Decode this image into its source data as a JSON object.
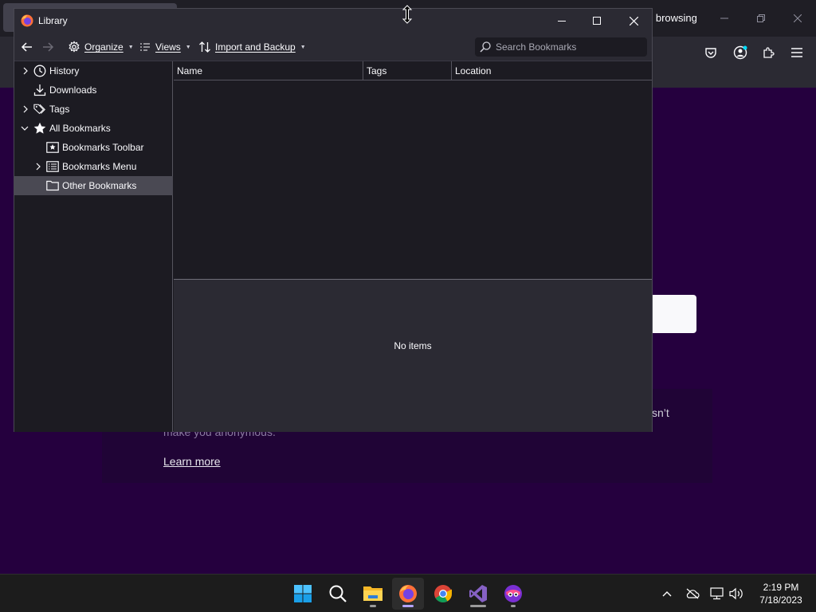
{
  "background": {
    "window_title_partial": "e browsing",
    "body_text_partial": "sn’t",
    "body_text_line2": "make you anonymous.",
    "learn_more": "Learn more"
  },
  "library": {
    "title": "Library",
    "toolbar": {
      "organize": "Organize",
      "views": "Views",
      "import_backup": "Import and Backup",
      "search_placeholder": "Search Bookmarks"
    },
    "tree": [
      {
        "label": "History",
        "icon": "clock-icon",
        "expandable": true,
        "expanded": false
      },
      {
        "label": "Downloads",
        "icon": "download-icon",
        "expandable": false
      },
      {
        "label": "Tags",
        "icon": "tag-icon",
        "expandable": true,
        "expanded": false
      },
      {
        "label": "All Bookmarks",
        "icon": "star-icon",
        "expandable": true,
        "expanded": true
      },
      {
        "label": "Bookmarks Toolbar",
        "icon": "bookmarks-toolbar-icon",
        "expandable": false
      },
      {
        "label": "Bookmarks Menu",
        "icon": "bookmarks-menu-icon",
        "expandable": true,
        "expanded": false
      },
      {
        "label": "Other Bookmarks",
        "icon": "folder-icon",
        "expandable": false,
        "selected": true
      }
    ],
    "columns": [
      "Name",
      "Tags",
      "Location"
    ],
    "details_empty": "No items"
  },
  "taskbar": {
    "apps": [
      "start-icon",
      "search-icon",
      "file-explorer-icon",
      "firefox-icon",
      "chrome-icon",
      "visual-studio-icon",
      "tor-browser-icon"
    ],
    "time": "2:19 PM",
    "date": "7/18/2023"
  },
  "colors": {
    "private_purple": "#25003e",
    "window_bg": "#1c1b22",
    "toolbar_bg": "#2b2a33",
    "selection": "#4a4953",
    "taskbar": "#1c1c1c"
  }
}
